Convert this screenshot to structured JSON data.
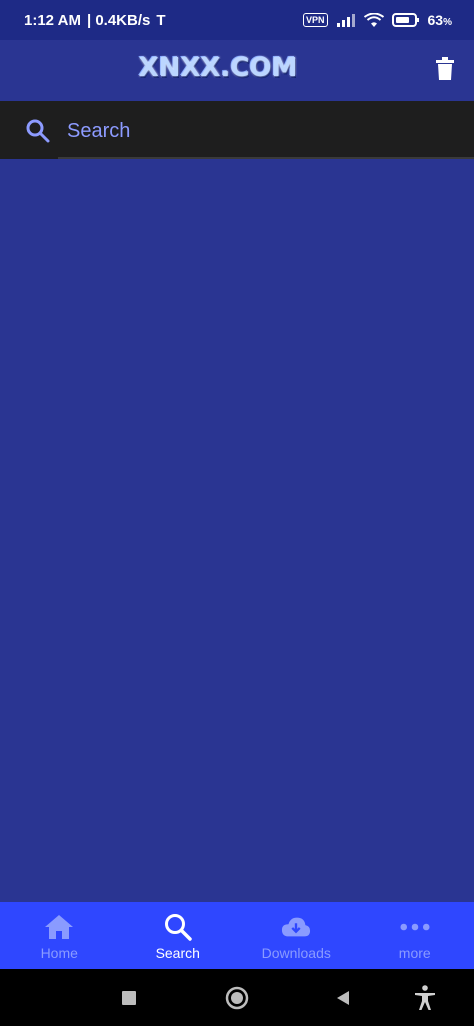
{
  "status_bar": {
    "time": "1:12 AM",
    "network_speed": "| 0.4KB/s",
    "carrier_icon": "T",
    "vpn_label": "VPN",
    "battery_percent": "63",
    "battery_suffix": "%"
  },
  "app_bar": {
    "logo_text": "XNXX.COM"
  },
  "search": {
    "placeholder": "Search",
    "value": ""
  },
  "bottom_nav": {
    "items": [
      {
        "label": "Home",
        "icon": "home-icon"
      },
      {
        "label": "Search",
        "icon": "search-icon"
      },
      {
        "label": "Downloads",
        "icon": "cloud-download-icon"
      },
      {
        "label": "more",
        "icon": "more-horizontal-icon"
      }
    ],
    "active_index": 1
  },
  "colors": {
    "app_background": "#2a3592",
    "status_bar": "#1e2a86",
    "search_bar": "#1e1e1e",
    "bottom_nav": "#2f47ff",
    "nav_inactive": "#8a9bff",
    "nav_active": "#ffffff"
  }
}
